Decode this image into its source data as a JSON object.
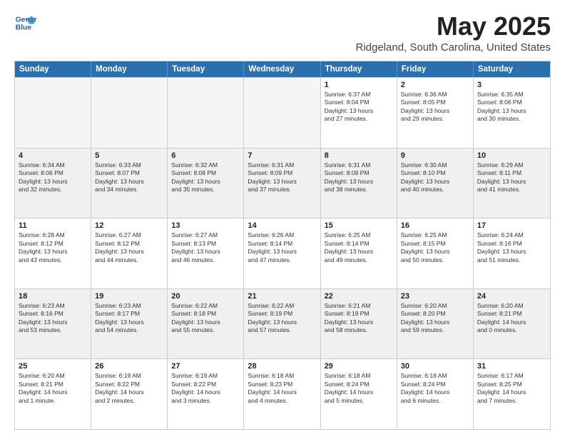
{
  "logo": {
    "line1": "General",
    "line2": "Blue"
  },
  "title": "May 2025",
  "subtitle": "Ridgeland, South Carolina, United States",
  "header_days": [
    "Sunday",
    "Monday",
    "Tuesday",
    "Wednesday",
    "Thursday",
    "Friday",
    "Saturday"
  ],
  "rows": [
    [
      {
        "day": "",
        "info": ""
      },
      {
        "day": "",
        "info": ""
      },
      {
        "day": "",
        "info": ""
      },
      {
        "day": "",
        "info": ""
      },
      {
        "day": "1",
        "info": "Sunrise: 6:37 AM\nSunset: 8:04 PM\nDaylight: 13 hours\nand 27 minutes."
      },
      {
        "day": "2",
        "info": "Sunrise: 6:36 AM\nSunset: 8:05 PM\nDaylight: 13 hours\nand 29 minutes."
      },
      {
        "day": "3",
        "info": "Sunrise: 6:35 AM\nSunset: 8:06 PM\nDaylight: 13 hours\nand 30 minutes."
      }
    ],
    [
      {
        "day": "4",
        "info": "Sunrise: 6:34 AM\nSunset: 8:06 PM\nDaylight: 13 hours\nand 32 minutes."
      },
      {
        "day": "5",
        "info": "Sunrise: 6:33 AM\nSunset: 8:07 PM\nDaylight: 13 hours\nand 34 minutes."
      },
      {
        "day": "6",
        "info": "Sunrise: 6:32 AM\nSunset: 8:08 PM\nDaylight: 13 hours\nand 35 minutes."
      },
      {
        "day": "7",
        "info": "Sunrise: 6:31 AM\nSunset: 8:09 PM\nDaylight: 13 hours\nand 37 minutes."
      },
      {
        "day": "8",
        "info": "Sunrise: 6:31 AM\nSunset: 8:09 PM\nDaylight: 13 hours\nand 38 minutes."
      },
      {
        "day": "9",
        "info": "Sunrise: 6:30 AM\nSunset: 8:10 PM\nDaylight: 13 hours\nand 40 minutes."
      },
      {
        "day": "10",
        "info": "Sunrise: 6:29 AM\nSunset: 8:11 PM\nDaylight: 13 hours\nand 41 minutes."
      }
    ],
    [
      {
        "day": "11",
        "info": "Sunrise: 6:28 AM\nSunset: 8:12 PM\nDaylight: 13 hours\nand 43 minutes."
      },
      {
        "day": "12",
        "info": "Sunrise: 6:27 AM\nSunset: 8:12 PM\nDaylight: 13 hours\nand 44 minutes."
      },
      {
        "day": "13",
        "info": "Sunrise: 6:27 AM\nSunset: 8:13 PM\nDaylight: 13 hours\nand 46 minutes."
      },
      {
        "day": "14",
        "info": "Sunrise: 6:26 AM\nSunset: 8:14 PM\nDaylight: 13 hours\nand 47 minutes."
      },
      {
        "day": "15",
        "info": "Sunrise: 6:25 AM\nSunset: 8:14 PM\nDaylight: 13 hours\nand 49 minutes."
      },
      {
        "day": "16",
        "info": "Sunrise: 6:25 AM\nSunset: 8:15 PM\nDaylight: 13 hours\nand 50 minutes."
      },
      {
        "day": "17",
        "info": "Sunrise: 6:24 AM\nSunset: 8:16 PM\nDaylight: 13 hours\nand 51 minutes."
      }
    ],
    [
      {
        "day": "18",
        "info": "Sunrise: 6:23 AM\nSunset: 8:16 PM\nDaylight: 13 hours\nand 53 minutes."
      },
      {
        "day": "19",
        "info": "Sunrise: 6:23 AM\nSunset: 8:17 PM\nDaylight: 13 hours\nand 54 minutes."
      },
      {
        "day": "20",
        "info": "Sunrise: 6:22 AM\nSunset: 8:18 PM\nDaylight: 13 hours\nand 55 minutes."
      },
      {
        "day": "21",
        "info": "Sunrise: 6:22 AM\nSunset: 8:19 PM\nDaylight: 13 hours\nand 57 minutes."
      },
      {
        "day": "22",
        "info": "Sunrise: 6:21 AM\nSunset: 8:19 PM\nDaylight: 13 hours\nand 58 minutes."
      },
      {
        "day": "23",
        "info": "Sunrise: 6:20 AM\nSunset: 8:20 PM\nDaylight: 13 hours\nand 59 minutes."
      },
      {
        "day": "24",
        "info": "Sunrise: 6:20 AM\nSunset: 8:21 PM\nDaylight: 14 hours\nand 0 minutes."
      }
    ],
    [
      {
        "day": "25",
        "info": "Sunrise: 6:20 AM\nSunset: 8:21 PM\nDaylight: 14 hours\nand 1 minute."
      },
      {
        "day": "26",
        "info": "Sunrise: 6:19 AM\nSunset: 8:22 PM\nDaylight: 14 hours\nand 2 minutes."
      },
      {
        "day": "27",
        "info": "Sunrise: 6:19 AM\nSunset: 8:22 PM\nDaylight: 14 hours\nand 3 minutes."
      },
      {
        "day": "28",
        "info": "Sunrise: 6:18 AM\nSunset: 8:23 PM\nDaylight: 14 hours\nand 4 minutes."
      },
      {
        "day": "29",
        "info": "Sunrise: 6:18 AM\nSunset: 8:24 PM\nDaylight: 14 hours\nand 5 minutes."
      },
      {
        "day": "30",
        "info": "Sunrise: 6:18 AM\nSunset: 8:24 PM\nDaylight: 14 hours\nand 6 minutes."
      },
      {
        "day": "31",
        "info": "Sunrise: 6:17 AM\nSunset: 8:25 PM\nDaylight: 14 hours\nand 7 minutes."
      }
    ]
  ]
}
